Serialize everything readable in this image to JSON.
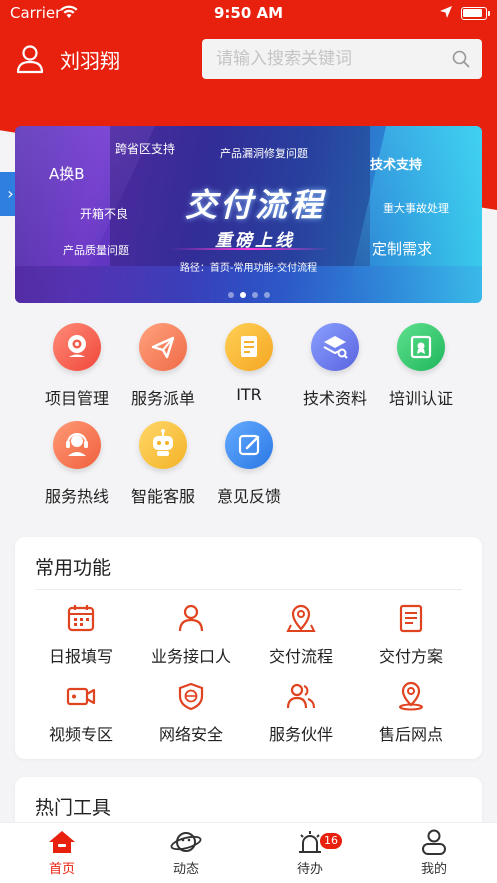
{
  "status_bar": {
    "carrier": "Carrier",
    "time": "9:50 AM"
  },
  "header": {
    "username": "刘羽翔",
    "search_placeholder": "请输入搜索关键词"
  },
  "banner": {
    "title": "交付流程",
    "subtitle": "重磅上线",
    "path": "路径：首页-常用功能-交付流程",
    "tags": [
      "A换B",
      "跨省区支持",
      "产品漏洞修复问题",
      "技术支持",
      "开箱不良",
      "重大事故处理",
      "产品质量问题",
      "定制需求"
    ],
    "page_count": 4,
    "active_page": 2
  },
  "services": [
    {
      "label": "项目管理",
      "icon": "webcam-icon",
      "color": "#f25a4a"
    },
    {
      "label": "服务派单",
      "icon": "paper-plane-icon",
      "color": "#f5845c"
    },
    {
      "label": "ITR",
      "icon": "document-icon",
      "color": "#f7b930"
    },
    {
      "label": "技术资料",
      "icon": "stack-search-icon",
      "color": "#6b7ef0"
    },
    {
      "label": "培训认证",
      "icon": "certificate-icon",
      "color": "#2ecc71"
    },
    {
      "label": "服务热线",
      "icon": "headset-icon",
      "color": "#f5845c"
    },
    {
      "label": "智能客服",
      "icon": "robot-icon",
      "color": "#f7c23a"
    },
    {
      "label": "意见反馈",
      "icon": "edit-icon",
      "color": "#3c8cf0"
    }
  ],
  "common_functions": {
    "title": "常用功能",
    "items": [
      {
        "label": "日报填写",
        "icon": "calendar-icon"
      },
      {
        "label": "业务接口人",
        "icon": "person-icon"
      },
      {
        "label": "交付流程",
        "icon": "map-pin-icon"
      },
      {
        "label": "交付方案",
        "icon": "document-list-icon"
      },
      {
        "label": "视频专区",
        "icon": "video-camera-icon"
      },
      {
        "label": "网络安全",
        "icon": "shield-network-icon"
      },
      {
        "label": "服务伙伴",
        "icon": "people-icon"
      },
      {
        "label": "售后网点",
        "icon": "location-pin-icon"
      }
    ]
  },
  "hot_tools": {
    "title": "热门工具"
  },
  "tabbar": {
    "tabs": [
      {
        "label": "首页",
        "icon": "home-icon"
      },
      {
        "label": "动态",
        "icon": "planet-icon"
      },
      {
        "label": "待办",
        "icon": "alarm-icon",
        "badge": "16"
      },
      {
        "label": "我的",
        "icon": "profile-icon"
      }
    ],
    "active": 0
  },
  "colors": {
    "brand_red": "#e8200e",
    "accent_icon": "#e0431f"
  }
}
